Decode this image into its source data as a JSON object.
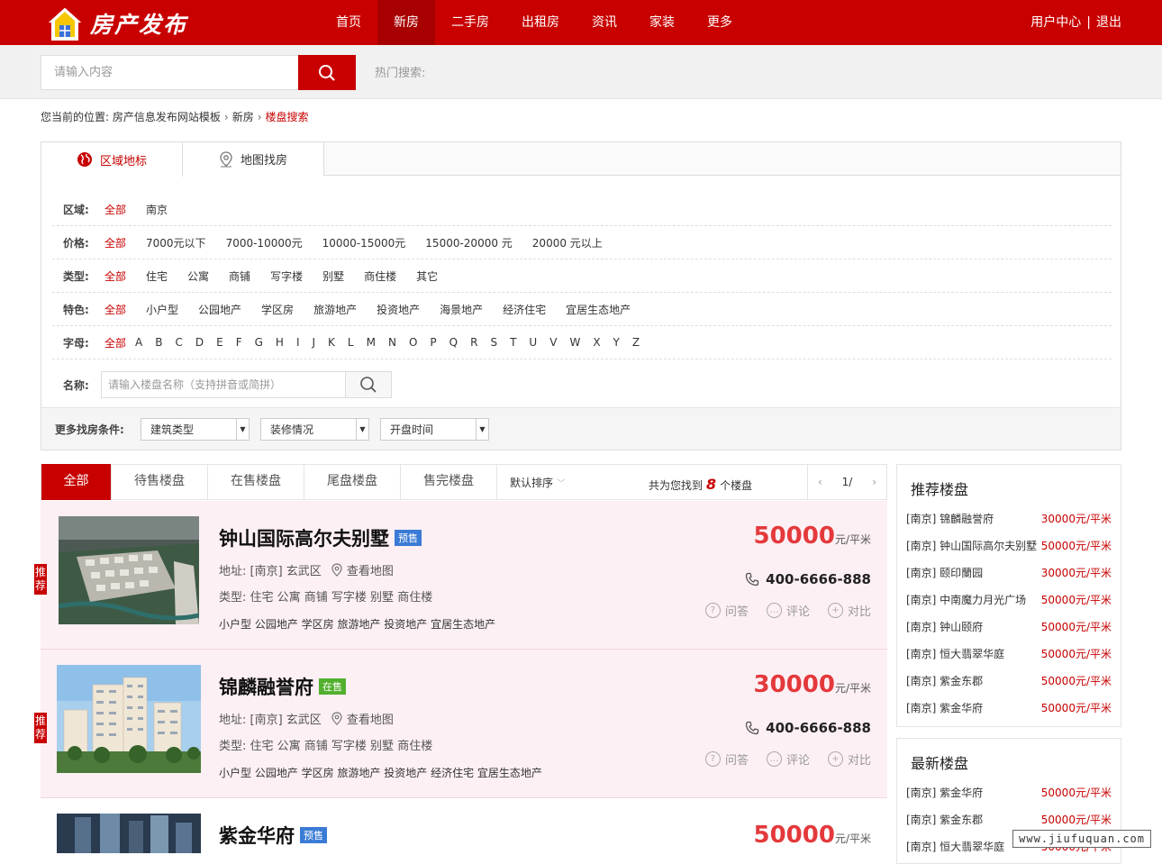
{
  "header": {
    "logo_text": "房产发布",
    "nav": [
      "首页",
      "新房",
      "二手房",
      "出租房",
      "资讯",
      "家装",
      "更多"
    ],
    "active_nav": 1,
    "user_center": "用户中心",
    "separator": "|",
    "logout": "退出"
  },
  "search": {
    "placeholder": "请输入内容",
    "hot_label": "热门搜索:"
  },
  "breadcrumb": {
    "prefix": "您当前的位置:",
    "items": [
      "房产信息发布网站模板",
      "新房",
      "楼盘搜索"
    ]
  },
  "filter": {
    "tabs": [
      "区域地标",
      "地图找房"
    ],
    "rows": [
      {
        "label": "区域:",
        "options": [
          "全部",
          "南京"
        ]
      },
      {
        "label": "价格:",
        "options": [
          "全部",
          "7000元以下",
          "7000-10000元",
          "10000-15000元",
          "15000-20000 元",
          "20000 元以上"
        ]
      },
      {
        "label": "类型:",
        "options": [
          "全部",
          "住宅",
          "公寓",
          "商铺",
          "写字楼",
          "别墅",
          "商住楼",
          "其它"
        ]
      },
      {
        "label": "特色:",
        "options": [
          "全部",
          "小户型",
          "公园地产",
          "学区房",
          "旅游地产",
          "投资地产",
          "海景地产",
          "经济住宅",
          "宜居生态地产"
        ]
      }
    ],
    "letter_label": "字母:",
    "letter_all": "全部",
    "letters": [
      "A",
      "B",
      "C",
      "D",
      "E",
      "F",
      "G",
      "H",
      "I",
      "J",
      "K",
      "L",
      "M",
      "N",
      "O",
      "P",
      "Q",
      "R",
      "S",
      "T",
      "U",
      "V",
      "W",
      "X",
      "Y",
      "Z"
    ],
    "name_label": "名称:",
    "name_placeholder": "请输入楼盘名称（支持拼音或简拼）",
    "more_label": "更多找房条件:",
    "selects": [
      "建筑类型",
      "装修情况",
      "开盘时间"
    ]
  },
  "list": {
    "tabs": [
      "全部",
      "待售楼盘",
      "在售楼盘",
      "尾盘楼盘",
      "售完楼盘"
    ],
    "sort": "默认排序",
    "found_prefix": "共为您找到",
    "found_count": "8",
    "found_suffix": "个楼盘",
    "page": "1/",
    "items": [
      {
        "name": "钟山国际高尔夫别墅",
        "status": "预售",
        "addr_label": "地址:",
        "addr": "[南京] 玄武区",
        "map_link": "查看地图",
        "type_label": "类型:",
        "types": "住宅 公寓 商铺 写字楼 别墅 商住楼",
        "tags": "小户型 公园地产 学区房 旅游地产 投资地产 宜居生态地产",
        "price": "50000",
        "unit": "元/平米",
        "tel": "400-6666-888",
        "recommend": "推荐"
      },
      {
        "name": "锦麟融誉府",
        "status": "在售",
        "addr_label": "地址:",
        "addr": "[南京] 玄武区",
        "map_link": "查看地图",
        "type_label": "类型:",
        "types": "住宅 公寓 商铺 写字楼 别墅 商住楼",
        "tags": "小户型 公园地产 学区房 旅游地产 投资地产 经济住宅 宜居生态地产",
        "price": "30000",
        "unit": "元/平米",
        "tel": "400-6666-888",
        "recommend": "推荐"
      },
      {
        "name": "紫金华府",
        "status": "预售",
        "price": "50000",
        "unit": "元/平米"
      }
    ],
    "actions": [
      "问答",
      "评论",
      "对比"
    ]
  },
  "recommended": {
    "title": "推荐楼盘",
    "items": [
      {
        "name": "[南京] 锦麟融誉府",
        "price": "30000元/平米"
      },
      {
        "name": "[南京] 钟山国际高尔夫别墅",
        "price": "50000元/平米"
      },
      {
        "name": "[南京] 颐印蘭园",
        "price": "30000元/平米"
      },
      {
        "name": "[南京] 中南魔力月光广场",
        "price": "50000元/平米"
      },
      {
        "name": "[南京] 钟山颐府",
        "price": "50000元/平米"
      },
      {
        "name": "[南京] 恒大翡翠华庭",
        "price": "50000元/平米"
      },
      {
        "name": "[南京] 紫金东郡",
        "price": "50000元/平米"
      },
      {
        "name": "[南京] 紫金华府",
        "price": "50000元/平米"
      }
    ]
  },
  "newest": {
    "title": "最新楼盘",
    "items": [
      {
        "name": "[南京] 紫金华府",
        "price": "50000元/平米"
      },
      {
        "name": "[南京] 紫金东郡",
        "price": "50000元/平米"
      },
      {
        "name": "[南京] 恒大翡翠华庭",
        "price": "50000元/平米"
      }
    ]
  },
  "watermark": "www.jiufuquan.com",
  "colors": {
    "brand": "#c80000",
    "price": "#e4393c",
    "presale_badge": "#3a7bd5",
    "onsale_badge": "#52b02e"
  }
}
